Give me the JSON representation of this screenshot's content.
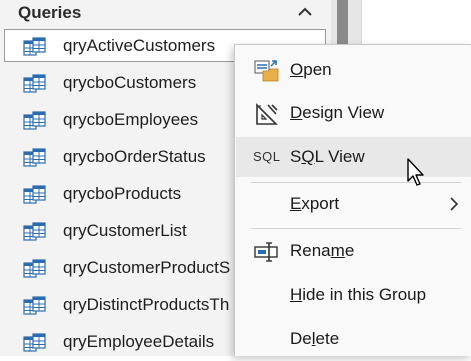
{
  "nav_pane": {
    "group_title": "Queries",
    "items": [
      {
        "label": "qryActiveCustomers",
        "selected": true
      },
      {
        "label": "qrycboCustomers"
      },
      {
        "label": "qrycboEmployees"
      },
      {
        "label": "qrycboOrderStatus"
      },
      {
        "label": "qrycboProducts"
      },
      {
        "label": "qryCustomerList"
      },
      {
        "label": "qryCustomerProductS"
      },
      {
        "label": "qryDistinctProductsTh"
      },
      {
        "label": "qryEmployeeDetails"
      }
    ]
  },
  "context_menu": {
    "items": [
      {
        "key": "open",
        "label_pre": "",
        "label_accel": "O",
        "label_post": "pen",
        "icon": "open-icon"
      },
      {
        "key": "design_view",
        "label_pre": "",
        "label_accel": "D",
        "label_post": "esign View",
        "icon": "design-view-icon"
      },
      {
        "key": "sql_view",
        "label_pre": "S",
        "label_accel": "Q",
        "label_post": "L View",
        "icon_text": "SQL",
        "hover": true
      },
      {
        "key": "export",
        "label_pre": "",
        "label_accel": "E",
        "label_post": "xport",
        "submenu": true
      },
      {
        "key": "rename",
        "label_pre": "Rena",
        "label_accel": "m",
        "label_post": "e",
        "icon": "rename-icon"
      },
      {
        "key": "hide",
        "label_pre": "",
        "label_accel": "H",
        "label_post": "ide in this Group"
      },
      {
        "key": "delete",
        "label_pre": "De",
        "label_accel": "l",
        "label_post": "ete"
      }
    ]
  },
  "colors": {
    "nav_background": "#f3f3f3",
    "menu_background": "#f9f9f9",
    "menu_hover": "#e8e8e8",
    "query_icon_blue": "#2b6cb0"
  }
}
